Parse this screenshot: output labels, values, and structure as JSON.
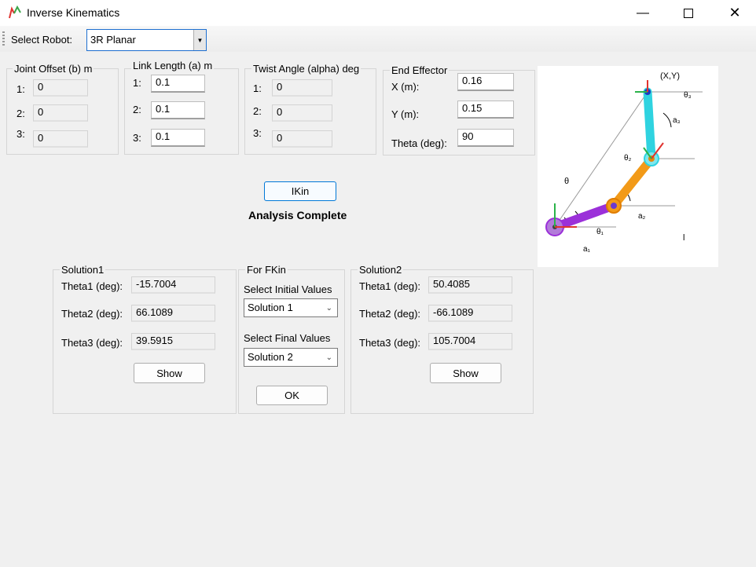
{
  "window": {
    "title": "Inverse Kinematics"
  },
  "toolbar": {
    "select_robot_label": "Select Robot:",
    "robot_value": "3R Planar"
  },
  "joint_offset": {
    "title": "Joint Offset (b) m",
    "rows": [
      {
        "idx": "1:",
        "value": "0"
      },
      {
        "idx": "2:",
        "value": "0"
      },
      {
        "idx": "3:",
        "value": "0"
      }
    ]
  },
  "link_length": {
    "title": "Link Length (a) m",
    "rows": [
      {
        "idx": "1:",
        "value": "0.1"
      },
      {
        "idx": "2:",
        "value": "0.1"
      },
      {
        "idx": "3:",
        "value": "0.1"
      }
    ]
  },
  "twist_angle": {
    "title": "Twist Angle (alpha) deg",
    "rows": [
      {
        "idx": "1:",
        "value": "0"
      },
      {
        "idx": "2:",
        "value": "0"
      },
      {
        "idx": "3:",
        "value": "0"
      }
    ]
  },
  "end_effector": {
    "title": "End Effector",
    "x_label": "X (m):",
    "x_value": "0.16",
    "y_label": "Y (m):",
    "y_value": "0.15",
    "theta_label": "Theta (deg):",
    "theta_value": "90"
  },
  "actions": {
    "ikin_label": "IKin",
    "status": "Analysis Complete"
  },
  "solution1": {
    "title": "Solution1",
    "theta1_label": "Theta1 (deg):",
    "theta1": "-15.7004",
    "theta2_label": "Theta2 (deg):",
    "theta2": "66.1089",
    "theta3_label": "Theta3 (deg):",
    "theta3": "39.5915",
    "show_label": "Show"
  },
  "fkin": {
    "title": "For FKin",
    "initial_label": "Select Initial Values",
    "initial_value": "Solution 1",
    "final_label": "Select Final Values",
    "final_value": "Solution 2",
    "ok_label": "OK"
  },
  "solution2": {
    "title": "Solution2",
    "theta1_label": "Theta1 (deg):",
    "theta1": "50.4085",
    "theta2_label": "Theta2 (deg):",
    "theta2": "-66.1089",
    "theta3_label": "Theta3 (deg):",
    "theta3": "105.7004",
    "show_label": "Show"
  },
  "diagram": {
    "xy_label": "(X,Y)",
    "theta": "θ",
    "theta1": "θ₁",
    "theta2": "θ₂",
    "theta3": "θ₃",
    "a1": "a₁",
    "a2": "a₂",
    "a3": "a₃",
    "l": "l"
  },
  "colors": {
    "link1": "#9b30d9",
    "link2": "#f29a18",
    "link3": "#2fd3e0",
    "accent": "#0078d7"
  }
}
